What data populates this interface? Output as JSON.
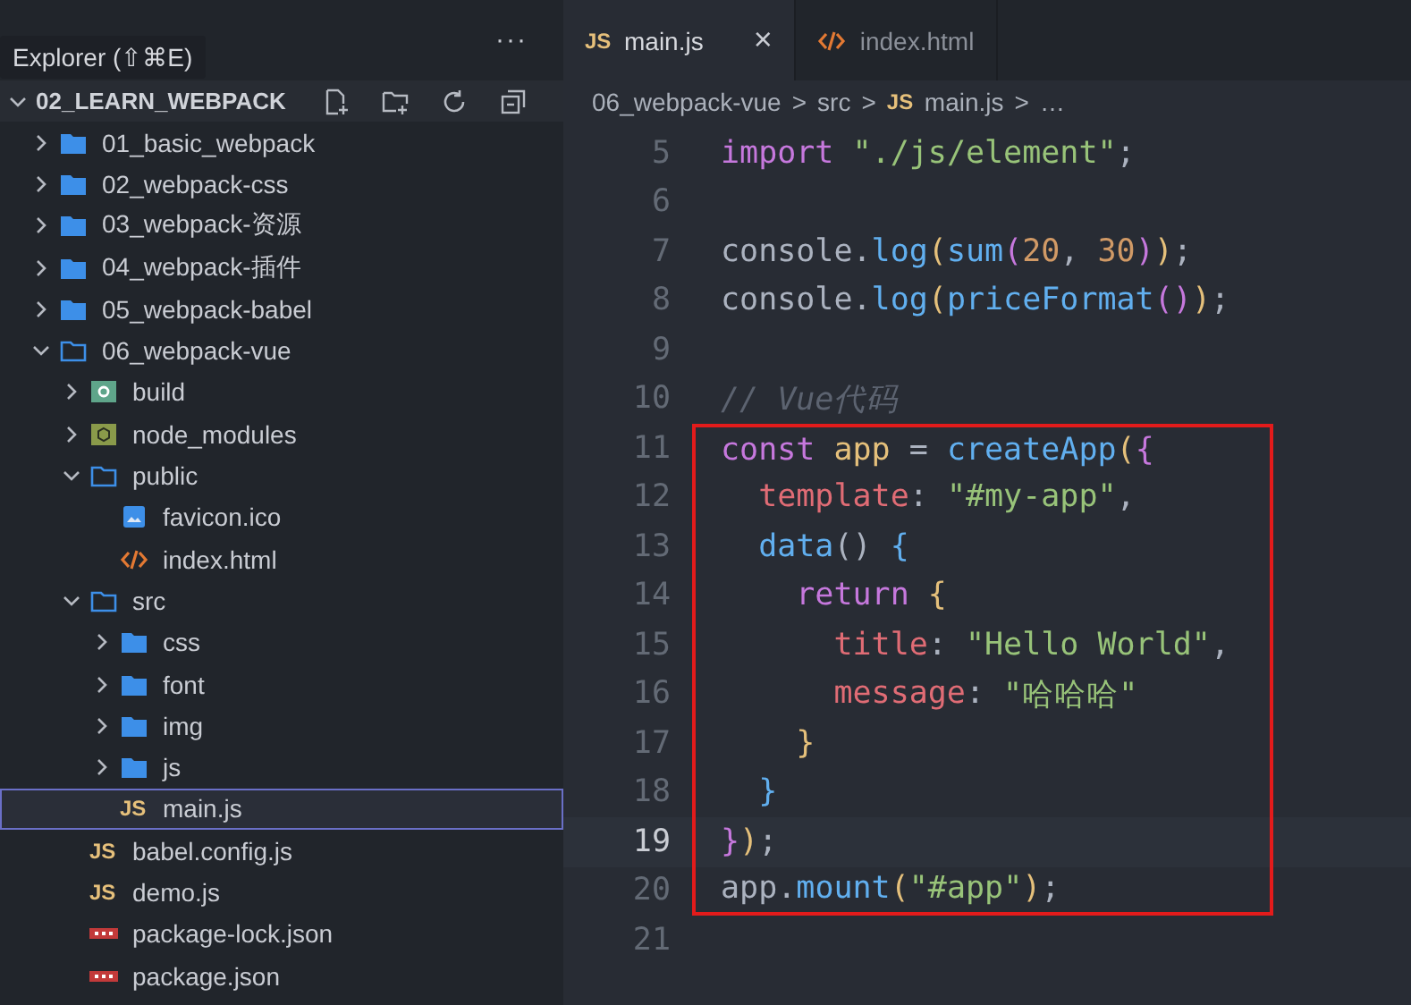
{
  "sidebar": {
    "tooltip": "Explorer (⇧⌘E)",
    "more": "···",
    "root": {
      "label": "02_LEARN_WEBPACK",
      "expanded": true
    },
    "tree": [
      {
        "label": "01_basic_webpack",
        "kind": "folder",
        "expanded": false,
        "selected": false
      },
      {
        "label": "02_webpack-css",
        "kind": "folder",
        "expanded": false,
        "selected": false
      },
      {
        "label": "03_webpack-资源",
        "kind": "folder",
        "expanded": false,
        "selected": false
      },
      {
        "label": "04_webpack-插件",
        "kind": "folder",
        "expanded": false,
        "selected": false
      },
      {
        "label": "05_webpack-babel",
        "kind": "folder",
        "expanded": false,
        "selected": false
      },
      {
        "label": "06_webpack-vue",
        "kind": "folder",
        "expanded": true,
        "selected": false,
        "children": [
          {
            "label": "build",
            "kind": "build",
            "expanded": false,
            "selected": false
          },
          {
            "label": "node_modules",
            "kind": "node",
            "expanded": false,
            "selected": false
          },
          {
            "label": "public",
            "kind": "folder",
            "expanded": true,
            "selected": false,
            "children": [
              {
                "label": "favicon.ico",
                "kind": "image",
                "selected": false
              },
              {
                "label": "index.html",
                "kind": "html",
                "selected": false
              }
            ]
          },
          {
            "label": "src",
            "kind": "folder",
            "expanded": true,
            "selected": false,
            "children": [
              {
                "label": "css",
                "kind": "folder",
                "expanded": false,
                "selected": false
              },
              {
                "label": "font",
                "kind": "folder",
                "expanded": false,
                "selected": false
              },
              {
                "label": "img",
                "kind": "folder",
                "expanded": false,
                "selected": false
              },
              {
                "label": "js",
                "kind": "folder",
                "expanded": false,
                "selected": false
              },
              {
                "label": "main.js",
                "kind": "js",
                "badge": "JS",
                "selected": true
              }
            ]
          },
          {
            "label": "babel.config.js",
            "kind": "js",
            "badge": "JS",
            "selected": false
          },
          {
            "label": "demo.js",
            "kind": "js",
            "badge": "JS",
            "selected": false
          },
          {
            "label": "package-lock.json",
            "kind": "npm",
            "selected": false
          },
          {
            "label": "package.json",
            "kind": "npm",
            "selected": false
          }
        ]
      }
    ]
  },
  "tabs": [
    {
      "label": "main.js",
      "kind": "js",
      "badge": "JS",
      "selected": true,
      "close": "×"
    },
    {
      "label": "index.html",
      "kind": "html",
      "selected": false
    }
  ],
  "breadcrumb": [
    {
      "label": "06_webpack-vue",
      "kind": "text"
    },
    {
      "label": "src",
      "kind": "text"
    },
    {
      "label": "main.js",
      "kind": "js",
      "badge": "JS"
    },
    {
      "label": "…",
      "kind": "text"
    }
  ],
  "breadcrumb_separator": ">",
  "code": [
    {
      "number": "5",
      "current": false,
      "highlighted": false,
      "tokens": [
        {
          "text": "import ",
          "kind": "kw"
        },
        {
          "text": "\"./js/element\"",
          "kind": "str"
        },
        {
          "text": ";",
          "kind": "p"
        }
      ]
    },
    {
      "number": "6",
      "current": false,
      "highlighted": false
    },
    {
      "number": "7",
      "current": false,
      "highlighted": false,
      "tokens": [
        {
          "text": "console.",
          "kind": "p"
        },
        {
          "text": "log",
          "kind": "fn"
        },
        {
          "text": "(",
          "kind": "y"
        },
        {
          "text": "sum",
          "kind": "fn"
        },
        {
          "text": "(",
          "kind": "pk"
        },
        {
          "text": "20",
          "kind": "num"
        },
        {
          "text": ", ",
          "kind": "p"
        },
        {
          "text": "30",
          "kind": "num"
        },
        {
          "text": ")",
          "kind": "pk"
        },
        {
          "text": ")",
          "kind": "y"
        },
        {
          "text": ";",
          "kind": "p"
        }
      ]
    },
    {
      "number": "8",
      "current": false,
      "highlighted": false,
      "tokens": [
        {
          "text": "console.",
          "kind": "p"
        },
        {
          "text": "log",
          "kind": "fn"
        },
        {
          "text": "(",
          "kind": "y"
        },
        {
          "text": "priceFormat",
          "kind": "fn"
        },
        {
          "text": "()",
          "kind": "pk"
        },
        {
          "text": ")",
          "kind": "y"
        },
        {
          "text": ";",
          "kind": "p"
        }
      ]
    },
    {
      "number": "9",
      "current": false,
      "highlighted": false
    },
    {
      "number": "10",
      "current": false,
      "highlighted": false,
      "tokens": [
        {
          "text": "// Vue代码",
          "kind": "cm"
        }
      ]
    },
    {
      "number": "11",
      "current": false,
      "highlighted": true,
      "tokens": [
        {
          "text": "const ",
          "kind": "kw"
        },
        {
          "text": "app",
          "kind": "var"
        },
        {
          "text": " = ",
          "kind": "p"
        },
        {
          "text": "createApp",
          "kind": "fn"
        },
        {
          "text": "(",
          "kind": "y"
        },
        {
          "text": "{",
          "kind": "pk"
        }
      ]
    },
    {
      "number": "12",
      "current": false,
      "highlighted": true,
      "tokens": [
        {
          "text": "  template",
          "kind": "prop"
        },
        {
          "text": ": ",
          "kind": "p"
        },
        {
          "text": "\"#my-app\"",
          "kind": "str"
        },
        {
          "text": ",",
          "kind": "p"
        }
      ]
    },
    {
      "number": "13",
      "current": false,
      "highlighted": true,
      "tokens": [
        {
          "text": "  data",
          "kind": "fn"
        },
        {
          "text": "() ",
          "kind": "p"
        },
        {
          "text": "{",
          "kind": "bl"
        }
      ]
    },
    {
      "number": "14",
      "current": false,
      "highlighted": true,
      "tokens": [
        {
          "text": "    return ",
          "kind": "kw"
        },
        {
          "text": "{",
          "kind": "y"
        }
      ]
    },
    {
      "number": "15",
      "current": false,
      "highlighted": true,
      "tokens": [
        {
          "text": "      title",
          "kind": "prop"
        },
        {
          "text": ": ",
          "kind": "p"
        },
        {
          "text": "\"Hello World\"",
          "kind": "str"
        },
        {
          "text": ",",
          "kind": "p"
        }
      ]
    },
    {
      "number": "16",
      "current": false,
      "highlighted": true,
      "tokens": [
        {
          "text": "      message",
          "kind": "prop"
        },
        {
          "text": ": ",
          "kind": "p"
        },
        {
          "text": "\"哈哈哈\"",
          "kind": "str"
        }
      ]
    },
    {
      "number": "17",
      "current": false,
      "highlighted": true,
      "tokens": [
        {
          "text": "    }",
          "kind": "y"
        }
      ]
    },
    {
      "number": "18",
      "current": false,
      "highlighted": true,
      "tokens": [
        {
          "text": "  }",
          "kind": "bl"
        }
      ]
    },
    {
      "number": "19",
      "current": true,
      "highlighted": true,
      "tokens": [
        {
          "text": "}",
          "kind": "pk"
        },
        {
          "text": ")",
          "kind": "y"
        },
        {
          "text": ";",
          "kind": "p"
        }
      ]
    },
    {
      "number": "20",
      "current": false,
      "highlighted": true,
      "tokens": [
        {
          "text": "app.",
          "kind": "p"
        },
        {
          "text": "mount",
          "kind": "fn"
        },
        {
          "text": "(",
          "kind": "y"
        },
        {
          "text": "\"#app\"",
          "kind": "str"
        },
        {
          "text": ")",
          "kind": "y"
        },
        {
          "text": ";",
          "kind": "p"
        }
      ]
    },
    {
      "number": "21",
      "current": false,
      "highlighted": false
    }
  ]
}
